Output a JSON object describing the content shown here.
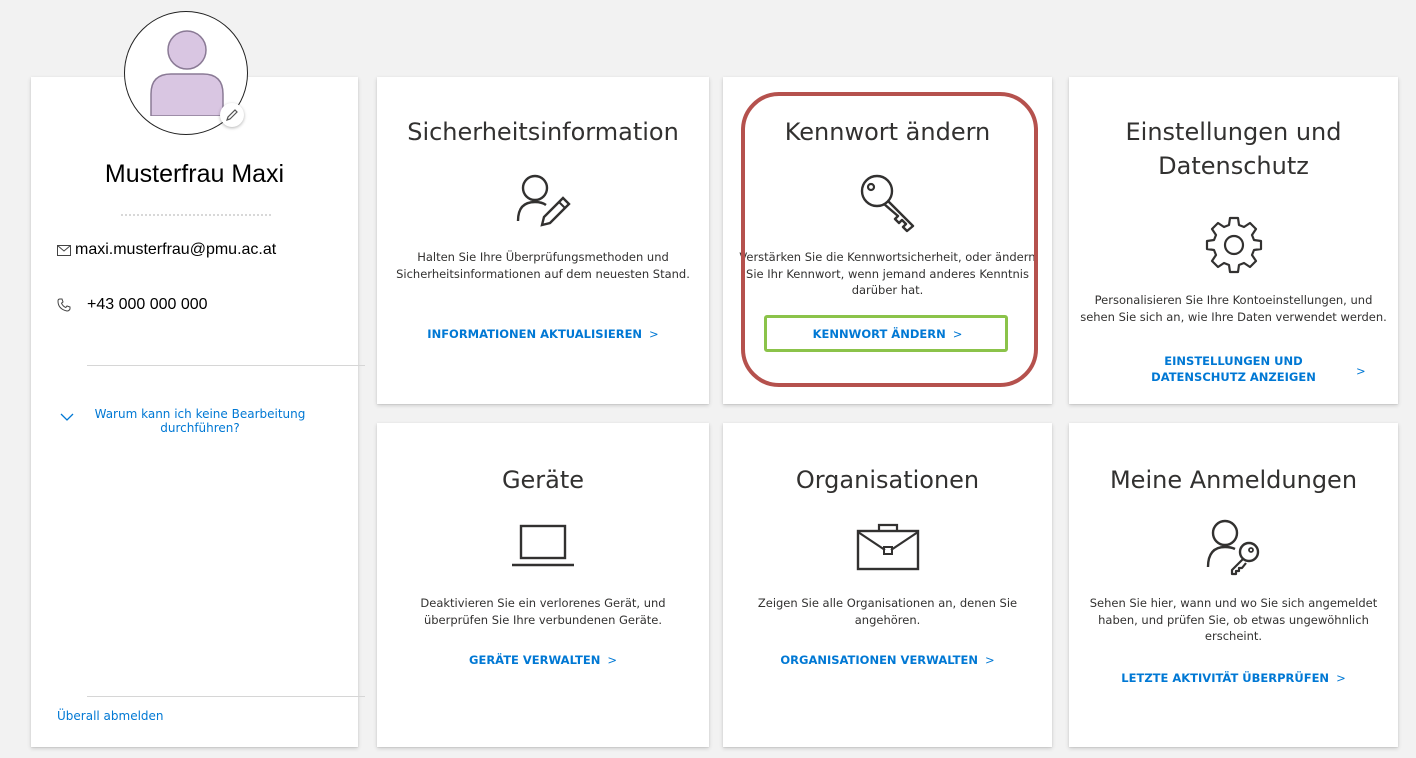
{
  "profile": {
    "name": "Musterfrau Maxi",
    "email": "maxi.musterfrau@pmu.ac.at",
    "phone": "+43 000 000 000",
    "why_cant_edit": "Warum kann ich keine Bearbeitung durchführen?",
    "sign_out": "Überall abmelden"
  },
  "tiles": [
    {
      "title": "Sicherheitsinformation",
      "icon": "user-edit-icon",
      "description": "Halten Sie Ihre Überprüfungsmethoden und Sicherheitsinformationen auf dem neuesten Stand.",
      "link": "INFORMATIONEN AKTUALISIEREN"
    },
    {
      "title": "Kennwort ändern",
      "icon": "key-icon",
      "description": "Verstärken Sie die Kennwortsicherheit, oder ändern Sie Ihr Kennwort, wenn jemand anderes Kenntnis darüber hat.",
      "link": "KENNWORT ÄNDERN"
    },
    {
      "title": "Einstellungen und Datenschutz",
      "icon": "gear-icon",
      "description": "Personalisieren Sie Ihre Kontoeinstellungen, und sehen Sie sich an, wie Ihre Daten verwendet werden.",
      "link": "EINSTELLUNGEN UND DATENSCHUTZ ANZEIGEN"
    },
    {
      "title": "Geräte",
      "icon": "laptop-icon",
      "description": "Deaktivieren Sie ein verlorenes Gerät, und überprüfen Sie Ihre verbundenen Geräte.",
      "link": "GERÄTE VERWALTEN"
    },
    {
      "title": "Organisationen",
      "icon": "briefcase-icon",
      "description": "Zeigen Sie alle Organisationen an, denen Sie angehören.",
      "link": "ORGANISATIONEN VERWALTEN"
    },
    {
      "title": "Meine Anmeldungen",
      "icon": "user-key-icon",
      "description": "Sehen Sie hier, wann und wo Sie sich angemeldet haben, und prüfen Sie, ob etwas ungewöhnlich erscheint.",
      "link": "LETZTE AKTIVITÄT ÜBERPRÜFEN"
    }
  ],
  "chevron": ">",
  "colors": {
    "link": "#0078d4",
    "highlight_red": "#b5514d",
    "highlight_green": "#8bc34a",
    "avatar_fill": "#d9c6e2"
  }
}
